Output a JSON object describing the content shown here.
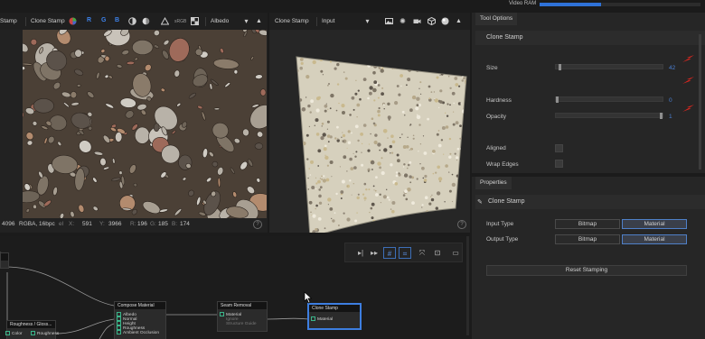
{
  "topbar": {
    "vram_label": "Video RAM",
    "vram_fraction": 0.38,
    "vram_color": "#2f72d8"
  },
  "view2d": {
    "toolbar": {
      "stamp_left": "Stamp",
      "tool_name": "Clone Stamp",
      "channels": [
        "R",
        "G",
        "B"
      ],
      "srgb": "sRGB",
      "channel_select": "Albedo",
      "icons": [
        "half-circle-icon",
        "half-circle-icon",
        "triangle-icon",
        "checker-icon",
        "grid-icon",
        "dropdown-icon",
        "collapse-icon"
      ]
    },
    "status": {
      "res": "4096",
      "format": "RGBA, 16bpc",
      "format_suffix": "el",
      "x_label": "X:",
      "x_value": "591",
      "y_label": "Y:",
      "y_value": "3966",
      "r_label": "R:",
      "r_value": "196",
      "g_label": "G:",
      "g_value": "185",
      "b_label": "B:",
      "b_value": "174",
      "help": "?"
    }
  },
  "view3d": {
    "toolbar": {
      "tool_name": "Clone Stamp",
      "mode": "Input",
      "icons": [
        "image-icon",
        "light-icon",
        "camera-icon",
        "cube-icon",
        "sphere-icon",
        "collapse-icon"
      ]
    },
    "help": "?"
  },
  "tool_options": {
    "tab": "Tool Options",
    "section": "Clone Stamp",
    "size": {
      "label": "Size",
      "value": "42",
      "fraction": 0.03
    },
    "hardness": {
      "label": "Hardness",
      "value": "0",
      "fraction": 0.0
    },
    "opacity": {
      "label": "Opacity",
      "value": "1",
      "fraction": 1.0
    },
    "aligned": {
      "label": "Aligned",
      "checked": false
    },
    "wrap_edges": {
      "label": "Wrap Edges",
      "checked": false
    },
    "arrow_color": "#e0261f"
  },
  "properties": {
    "tab": "Properties",
    "section": "Clone Stamp",
    "input_type": {
      "label": "Input Type",
      "options": [
        "Bitmap",
        "Material"
      ],
      "selected": "Material"
    },
    "output_type": {
      "label": "Output Type",
      "options": [
        "Bitmap",
        "Material"
      ],
      "selected": "Material"
    },
    "reset_button": "Reset Stamping"
  },
  "graph": {
    "toolbar_icons": [
      "play-icon",
      "step-icon",
      "grid-icon",
      "grid-snap-icon",
      "fit-icon",
      "frame-icon",
      "panel-icon"
    ],
    "nodes": {
      "roughness_gloss": {
        "title": "Roughness / Gloss...",
        "ports": [
          "Color",
          "Roughness"
        ]
      },
      "compose_material": {
        "title": "Compose Material",
        "ports": [
          "Albedo",
          "Normal",
          "Height",
          "Roughness",
          "Ambient Occlusion"
        ]
      },
      "seam_removal": {
        "title": "Seam Removal",
        "ports": [
          "Material",
          "Ignore",
          "Structure Guide"
        ]
      },
      "clone_stamp": {
        "title": "Clone Stamp",
        "ports": [
          "Material"
        ]
      }
    }
  }
}
